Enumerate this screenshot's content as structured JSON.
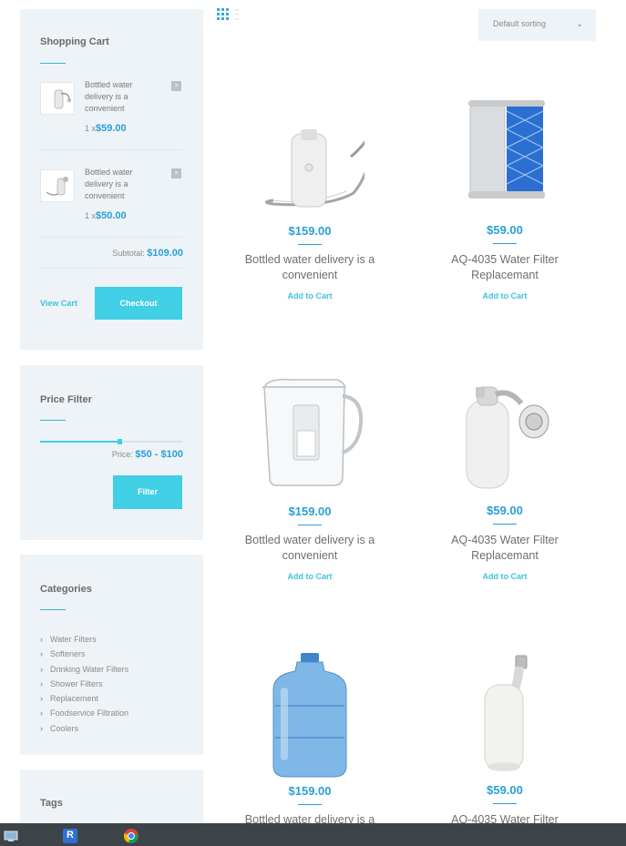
{
  "sidebar": {
    "cart": {
      "title": "Shopping Cart",
      "items": [
        {
          "name": "Bottled water delivery is a convenient",
          "qty": "1 x",
          "price": "$59.00",
          "remove": "×"
        },
        {
          "name": "Bottled water delivery is a convenient",
          "qty": "1 x",
          "price": "$50.00",
          "remove": "×"
        }
      ],
      "subtotal_label": "Subtotal:",
      "subtotal_value": "$109.00",
      "view_cart": "View Cart",
      "checkout": "Checkout"
    },
    "price_filter": {
      "title": "Price Filter",
      "range_low": 0.0,
      "range_high": 0.56,
      "price_label": "Price:",
      "price_range": "$50 - $100",
      "filter_button": "Filter"
    },
    "categories": {
      "title": "Categories",
      "items": [
        "Water Filters",
        "Softeners",
        "Drinking Water Filters",
        "Shower Filters",
        "Replacement",
        "Foodservice Filtration",
        "Coolers"
      ]
    },
    "tags": {
      "title": "Tags"
    }
  },
  "toolbar": {
    "view_icon": "grid-view-icon",
    "sort_value": "Default sorting"
  },
  "products": [
    {
      "price": "$159.00",
      "name": "Bottled water delivery is a convenient",
      "add": "Add to Cart",
      "image": "shower-filter-hose"
    },
    {
      "price": "$59.00",
      "name": "AQ-4035 Water Filter Replacemant",
      "add": "Add to Cart",
      "image": "filter-cartridge"
    },
    {
      "price": "$159.00",
      "name": "Bottled water delivery is a convenient",
      "add": "Add to Cart",
      "image": "water-pitcher"
    },
    {
      "price": "$59.00",
      "name": "AQ-4035 Water Filter Replacemant",
      "add": "Add to Cart",
      "image": "shower-head-filter"
    },
    {
      "price": "$159.00",
      "name": "Bottled water delivery is a",
      "add": "",
      "image": "water-jug"
    },
    {
      "price": "$59.00",
      "name": "AQ-4035 Water Filter",
      "add": "",
      "image": "inline-filter"
    }
  ],
  "taskbar": {
    "apps": [
      "computer-icon",
      "r-app-icon",
      "chrome-icon"
    ],
    "r_letter": "R"
  },
  "colors": {
    "accent": "#40cfe4",
    "price_blue": "#2a9fd8",
    "widget_bg": "#eef3f7",
    "taskbar": "#3d4447"
  }
}
